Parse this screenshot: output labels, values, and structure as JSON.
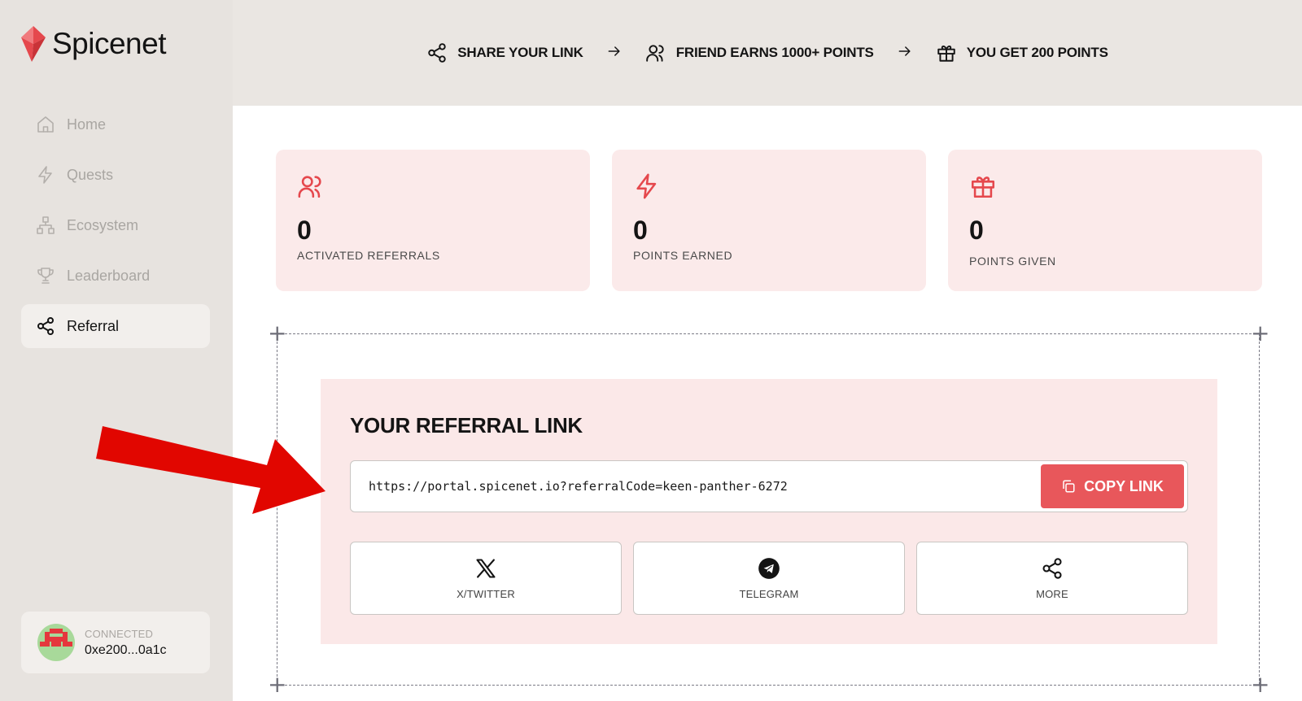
{
  "brand": {
    "name": "Spicenet",
    "accent_color": "#e5484d"
  },
  "sidebar": {
    "items": [
      {
        "label": "Home",
        "icon": "home-icon",
        "active": false
      },
      {
        "label": "Quests",
        "icon": "lightning-icon",
        "active": false
      },
      {
        "label": "Ecosystem",
        "icon": "sitemap-icon",
        "active": false
      },
      {
        "label": "Leaderboard",
        "icon": "trophy-icon",
        "active": false
      },
      {
        "label": "Referral",
        "icon": "share-icon",
        "active": true
      }
    ],
    "wallet": {
      "status": "CONNECTED",
      "address": "0xe200...0a1c"
    }
  },
  "steps": [
    {
      "label": "SHARE YOUR LINK",
      "icon": "share-icon"
    },
    {
      "label": "FRIEND EARNS 1000+ POINTS",
      "icon": "users-icon"
    },
    {
      "label": "YOU GET 200 POINTS",
      "icon": "gift-icon"
    }
  ],
  "stats": [
    {
      "value": "0",
      "label": "ACTIVATED REFERRALS",
      "icon": "users-icon"
    },
    {
      "value": "0",
      "label": "POINTS EARNED",
      "icon": "lightning-icon"
    },
    {
      "value": "0",
      "label": "POINTS GIVEN",
      "icon": "gift-icon"
    }
  ],
  "referral": {
    "title": "YOUR REFERRAL LINK",
    "link": "https://portal.spicenet.io?referralCode=keen-panther-6272",
    "copy_label": "COPY LINK",
    "share_buttons": [
      {
        "label": "X/TWITTER",
        "icon": "x-twitter-icon"
      },
      {
        "label": "TELEGRAM",
        "icon": "telegram-icon"
      },
      {
        "label": "MORE",
        "icon": "share-icon"
      }
    ]
  },
  "colors": {
    "sidebar_bg": "#e7e3df",
    "card_bg": "#fbeaea",
    "copy_button": "#e8575b"
  }
}
